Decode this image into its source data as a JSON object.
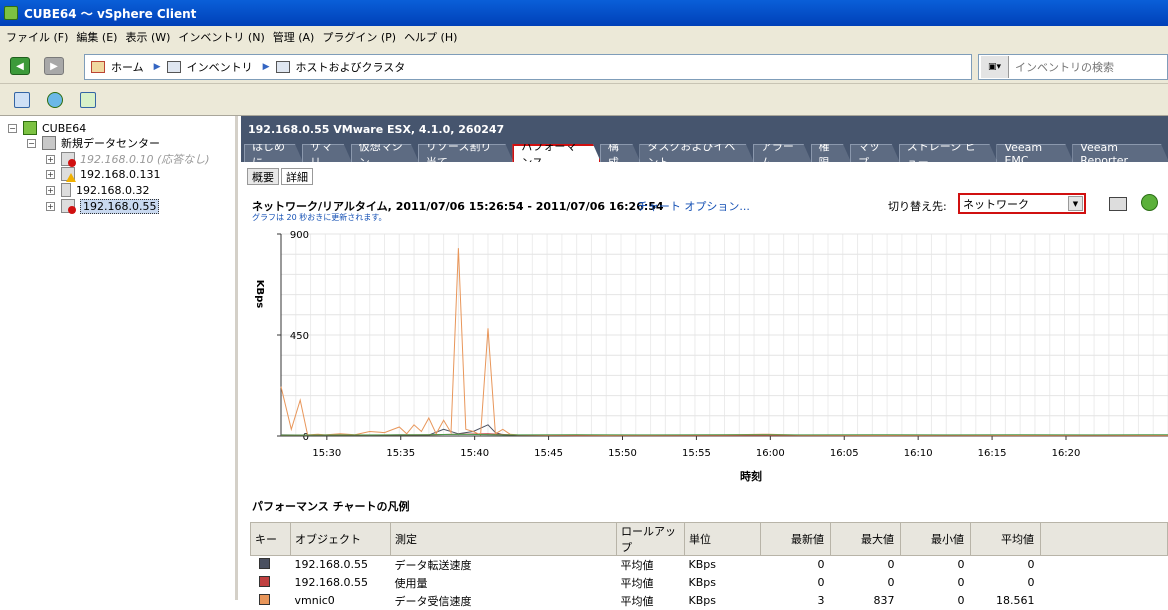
{
  "window": {
    "title": "CUBE64 ～ vSphere Client"
  },
  "menu": [
    "ファイル (F)",
    "編集 (E)",
    "表示 (W)",
    "インベントリ (N)",
    "管理 (A)",
    "プラグイン (P)",
    "ヘルプ (H)"
  ],
  "breadcrumb": [
    "ホーム",
    "インベントリ",
    "ホストおよびクラスタ"
  ],
  "search": {
    "placeholder": "インベントリの検索"
  },
  "tree": {
    "root": "CUBE64",
    "datacenter": "新規データセンター",
    "hosts": [
      "192.168.0.10 (応答なし)",
      "192.168.0.131",
      "192.168.0.32",
      "192.168.0.55"
    ]
  },
  "host": {
    "title": "192.168.0.55 VMware ESX, 4.1.0, 260247",
    "tabs": [
      "はじめに",
      "サマリ",
      "仮想マシン",
      "リソース割り当て",
      "パフォーマンス",
      "構成",
      "タスクおよびイベント",
      "アラーム",
      "権限",
      "マップ",
      "ストレージ ビュー",
      "Veeam EMC",
      "Veeam Reporter"
    ],
    "active_tab": 4,
    "subtabs": [
      "概要",
      "詳細"
    ]
  },
  "perf": {
    "heading": "ネットワーク/リアルタイム, 2011/07/06 15:26:54 - 2011/07/06 16:26:54",
    "chart_options": "チャート オプション...",
    "refresh_note": "グラフは 20 秒おきに更新されます。",
    "switch_label": "切り替え先:",
    "switch_value": "ネットワーク"
  },
  "chart_data": {
    "type": "line",
    "xlabel": "時刻",
    "ylabel": "KBps",
    "ylim": [
      0,
      900
    ],
    "yticks": [
      0,
      450,
      900
    ],
    "xticks": [
      "15:30",
      "15:35",
      "15:40",
      "15:45",
      "15:50",
      "15:55",
      "16:00",
      "16:05",
      "16:10",
      "16:15",
      "16:20"
    ],
    "xrange_minutes": [
      0,
      60
    ],
    "grid": true,
    "series": [
      {
        "name": "192.168.0.55 データ転送速度",
        "color": "#4a5060",
        "points": [
          [
            0,
            5
          ],
          [
            2,
            4
          ],
          [
            4,
            6
          ],
          [
            6,
            3
          ],
          [
            8,
            5
          ],
          [
            10,
            4
          ],
          [
            11,
            30
          ],
          [
            12,
            10
          ],
          [
            13,
            20
          ],
          [
            14,
            50
          ],
          [
            14.5,
            15
          ],
          [
            15,
            6
          ],
          [
            16,
            4
          ],
          [
            18,
            3
          ],
          [
            20,
            2
          ],
          [
            25,
            2
          ],
          [
            30,
            2
          ],
          [
            35,
            2
          ],
          [
            40,
            2
          ],
          [
            45,
            2
          ],
          [
            50,
            2
          ],
          [
            55,
            2
          ],
          [
            60,
            2
          ]
        ]
      },
      {
        "name": "192.168.0.55 使用量",
        "color": "#c04040",
        "points": [
          [
            0,
            3
          ],
          [
            5,
            4
          ],
          [
            10,
            6
          ],
          [
            12,
            8
          ],
          [
            14,
            10
          ],
          [
            16,
            4
          ],
          [
            20,
            2
          ],
          [
            30,
            2
          ],
          [
            40,
            2
          ],
          [
            50,
            2
          ],
          [
            60,
            2
          ]
        ]
      },
      {
        "name": "vmnic0 データ受信速度",
        "color": "#e8965a",
        "points": [
          [
            0,
            220
          ],
          [
            0.7,
            30
          ],
          [
            1.3,
            160
          ],
          [
            1.8,
            5
          ],
          [
            2.5,
            8
          ],
          [
            3,
            5
          ],
          [
            4,
            10
          ],
          [
            5,
            6
          ],
          [
            6,
            20
          ],
          [
            7,
            15
          ],
          [
            8,
            40
          ],
          [
            8.5,
            10
          ],
          [
            9,
            50
          ],
          [
            9.5,
            20
          ],
          [
            10,
            80
          ],
          [
            10.5,
            10
          ],
          [
            11,
            70
          ],
          [
            11.5,
            15
          ],
          [
            12,
            837
          ],
          [
            12.5,
            30
          ],
          [
            13,
            20
          ],
          [
            13.5,
            5
          ],
          [
            14,
            480
          ],
          [
            14.5,
            10
          ],
          [
            15,
            30
          ],
          [
            15.5,
            8
          ],
          [
            16,
            5
          ],
          [
            18,
            4
          ],
          [
            20,
            5
          ],
          [
            22,
            3
          ],
          [
            25,
            4
          ],
          [
            30,
            5
          ],
          [
            33,
            8
          ],
          [
            35,
            4
          ],
          [
            40,
            3
          ],
          [
            45,
            4
          ],
          [
            50,
            3
          ],
          [
            55,
            4
          ],
          [
            60,
            3
          ]
        ]
      },
      {
        "name": "",
        "color": "#4a9a4a",
        "points": [
          [
            0,
            4
          ],
          [
            10,
            6
          ],
          [
            12,
            8
          ],
          [
            15,
            5
          ],
          [
            20,
            6
          ],
          [
            25,
            5
          ],
          [
            30,
            6
          ],
          [
            35,
            5
          ],
          [
            40,
            6
          ],
          [
            45,
            5
          ],
          [
            50,
            6
          ],
          [
            55,
            5
          ],
          [
            60,
            6
          ]
        ]
      }
    ]
  },
  "legend": {
    "title": "パフォーマンス チャートの凡例",
    "columns": [
      "キー",
      "オブジェクト",
      "測定",
      "ロールアップ",
      "単位",
      "最新値",
      "最大値",
      "最小値",
      "平均値"
    ],
    "rows": [
      {
        "color": "#4a5060",
        "object": "192.168.0.55",
        "measure": "データ転送速度",
        "rollup": "平均値",
        "unit": "KBps",
        "latest": "0",
        "max": "0",
        "min": "0",
        "avg": "0"
      },
      {
        "color": "#c04040",
        "object": "192.168.0.55",
        "measure": "使用量",
        "rollup": "平均値",
        "unit": "KBps",
        "latest": "0",
        "max": "0",
        "min": "0",
        "avg": "0"
      },
      {
        "color": "#e8965a",
        "object": "vmnic0",
        "measure": "データ受信速度",
        "rollup": "平均値",
        "unit": "KBps",
        "latest": "3",
        "max": "837",
        "min": "0",
        "avg": "18.561"
      }
    ]
  }
}
